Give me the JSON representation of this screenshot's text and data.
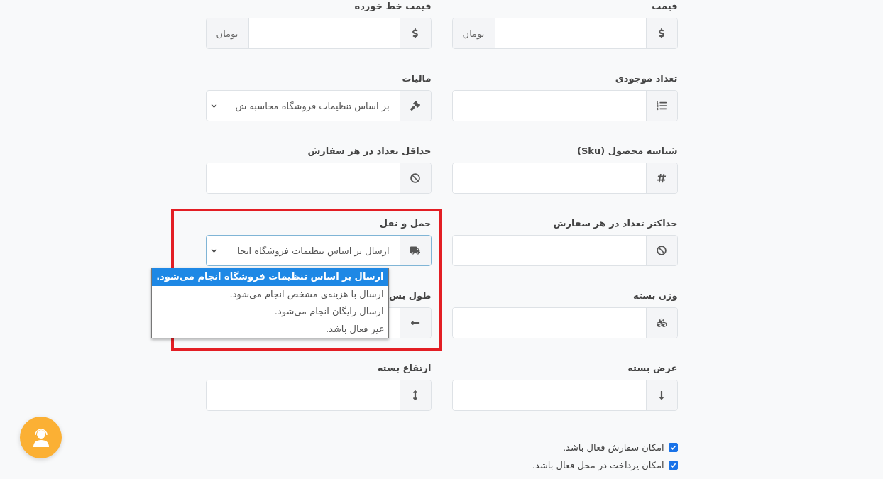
{
  "fields": [
    {
      "label": "قیمت",
      "kind": "input",
      "suffix": "تومان"
    },
    {
      "label": "قیمت خط خورده",
      "kind": "input",
      "suffix": "تومان"
    },
    {
      "label": "تعداد موجودی",
      "kind": "input"
    },
    {
      "label": "مالیات",
      "kind": "select",
      "value": "بر اساس تنظیمات فروشگاه محاسبه ش",
      "focused": false
    },
    {
      "label": "شناسه محصول (Sku)",
      "kind": "input"
    },
    {
      "label": "حداقل تعداد در هر سفارش",
      "kind": "input"
    },
    {
      "label": "حداکثر تعداد در هر سفارش",
      "kind": "input"
    },
    {
      "label": "حمل و نقل",
      "kind": "select",
      "value": "ارسال بر اساس تنظیمات فروشگاه انجا",
      "focused": true,
      "highlighted": true,
      "options": [
        {
          "label": "ارسال بر اساس تنظیمات فروشگاه انجام می‌شود.",
          "selected": true
        },
        {
          "label": "ارسال با هزینه‌ی مشخص انجام می‌شود.",
          "selected": false
        },
        {
          "label": "ارسال رایگان انجام می‌شود.",
          "selected": false
        },
        {
          "label": "غیر فعال باشد.",
          "selected": false
        }
      ]
    },
    {
      "label": "وزن بسته",
      "kind": "input"
    },
    {
      "label": "طول بس",
      "kind": "input"
    },
    {
      "label": "عرض بسته",
      "kind": "input"
    },
    {
      "label": "ارتفاع بسته",
      "kind": "input"
    }
  ],
  "checkboxes": [
    {
      "label": "امکان سفارش فعال باشد.",
      "checked": true
    },
    {
      "label": "امکان پرداخت در محل فعال باشد.",
      "checked": true
    }
  ]
}
